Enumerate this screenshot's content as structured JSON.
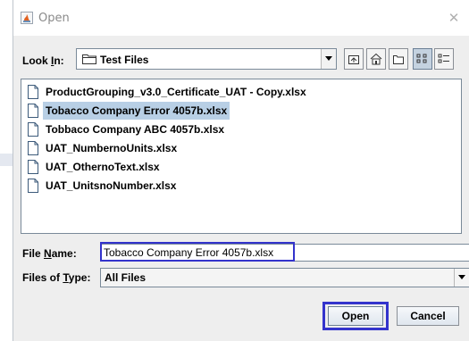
{
  "window": {
    "title": "Open"
  },
  "look_in": {
    "label_prefix": "Look ",
    "label_mnemonic": "I",
    "label_suffix": "n:",
    "value": "Test Files"
  },
  "files": [
    {
      "name": "ProductGrouping_v3.0_Certificate_UAT - Copy.xlsx"
    },
    {
      "name": "Tobacco Company Error 4057b.xlsx",
      "selected": true
    },
    {
      "name": "Tobbaco Company ABC 4057b.xlsx"
    },
    {
      "name": "UAT_NumbernoUnits.xlsx"
    },
    {
      "name": "UAT_OthernoText.xlsx"
    },
    {
      "name": "UAT_UnitsnoNumber.xlsx"
    }
  ],
  "file_name": {
    "label_prefix": "File ",
    "label_mnemonic": "N",
    "label_suffix": "ame:",
    "value": "Tobacco Company Error 4057b.xlsx"
  },
  "file_type": {
    "label_prefix": "Files of ",
    "label_mnemonic": "T",
    "label_suffix": "ype:",
    "value": "All Files"
  },
  "buttons": {
    "open": "Open",
    "cancel": "Cancel"
  },
  "colors": {
    "selection": "#b8cfe5",
    "highlight_box": "#3333cc",
    "background": "#eeeeee"
  }
}
